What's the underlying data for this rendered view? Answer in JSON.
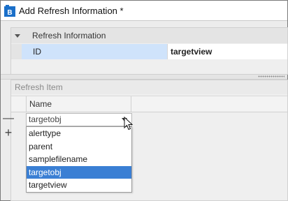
{
  "window": {
    "title": "Add Refresh Information *",
    "app_icon": "builder-app-icon"
  },
  "info_section": {
    "label": "Refresh Information",
    "rows": [
      {
        "key": "ID",
        "value": "targetview"
      }
    ]
  },
  "items_section": {
    "label": "Refresh Item",
    "column_header": "Name",
    "remove_glyph": "—",
    "add_glyph": "+",
    "combo_value": "targetobj",
    "options": [
      {
        "label": "alerttype",
        "selected": false
      },
      {
        "label": "parent",
        "selected": false
      },
      {
        "label": "samplefilename",
        "selected": false
      },
      {
        "label": "targetobj",
        "selected": true
      },
      {
        "label": "targetview",
        "selected": false
      }
    ]
  },
  "colors": {
    "selection": "#3a7fd4",
    "key_cell": "#cfe3fb",
    "icon_blue": "#1a6fc9"
  }
}
